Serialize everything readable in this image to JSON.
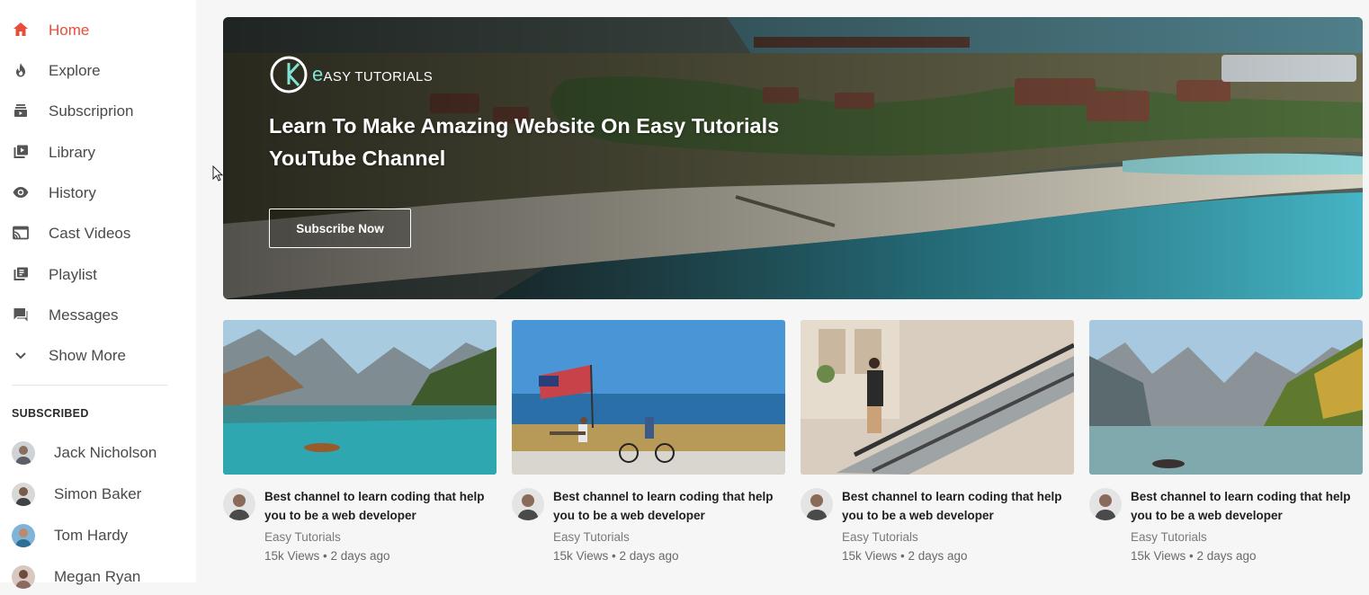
{
  "sidebar": {
    "items": [
      {
        "label": "Home",
        "icon": "home-icon",
        "active": true
      },
      {
        "label": "Explore",
        "icon": "flame-icon",
        "active": false
      },
      {
        "label": "Subscriprion",
        "icon": "subscription-icon",
        "active": false
      },
      {
        "label": "Library",
        "icon": "library-icon",
        "active": false
      },
      {
        "label": "History",
        "icon": "history-eye-icon",
        "active": false
      },
      {
        "label": "Cast Videos",
        "icon": "cast-icon",
        "active": false
      },
      {
        "label": "Playlist",
        "icon": "playlist-icon",
        "active": false
      },
      {
        "label": "Messages",
        "icon": "messages-icon",
        "active": false
      },
      {
        "label": "Show More",
        "icon": "chevron-down-icon",
        "active": false
      }
    ],
    "subscribed_title": "SUBSCRIBED",
    "subscribed": [
      {
        "name": "Jack Nicholson"
      },
      {
        "name": "Simon Baker"
      },
      {
        "name": "Tom Hardy"
      },
      {
        "name": "Megan Ryan"
      }
    ]
  },
  "banner": {
    "brand_initial": "e",
    "brand_name": "ASY TUTORIALS",
    "title": "Learn To Make Amazing Website On Easy Tutorials YouTube Channel",
    "button_label": "Subscribe Now"
  },
  "videos": [
    {
      "title": "Best channel to learn coding that help you to be a web developer",
      "channel": "Easy Tutorials",
      "meta": "15k Views • 2 days ago"
    },
    {
      "title": "Best channel to learn coding that help you to be a web developer",
      "channel": "Easy Tutorials",
      "meta": "15k Views • 2 days ago"
    },
    {
      "title": "Best channel to learn coding that help you to be a web developer",
      "channel": "Easy Tutorials",
      "meta": "15k Views • 2 days ago"
    },
    {
      "title": "Best channel to learn coding that help you to be a web developer",
      "channel": "Easy Tutorials",
      "meta": "15k Views • 2 days ago"
    }
  ],
  "colors": {
    "accent": "#ea4c3a",
    "brand_teal": "#7fe3d3"
  }
}
